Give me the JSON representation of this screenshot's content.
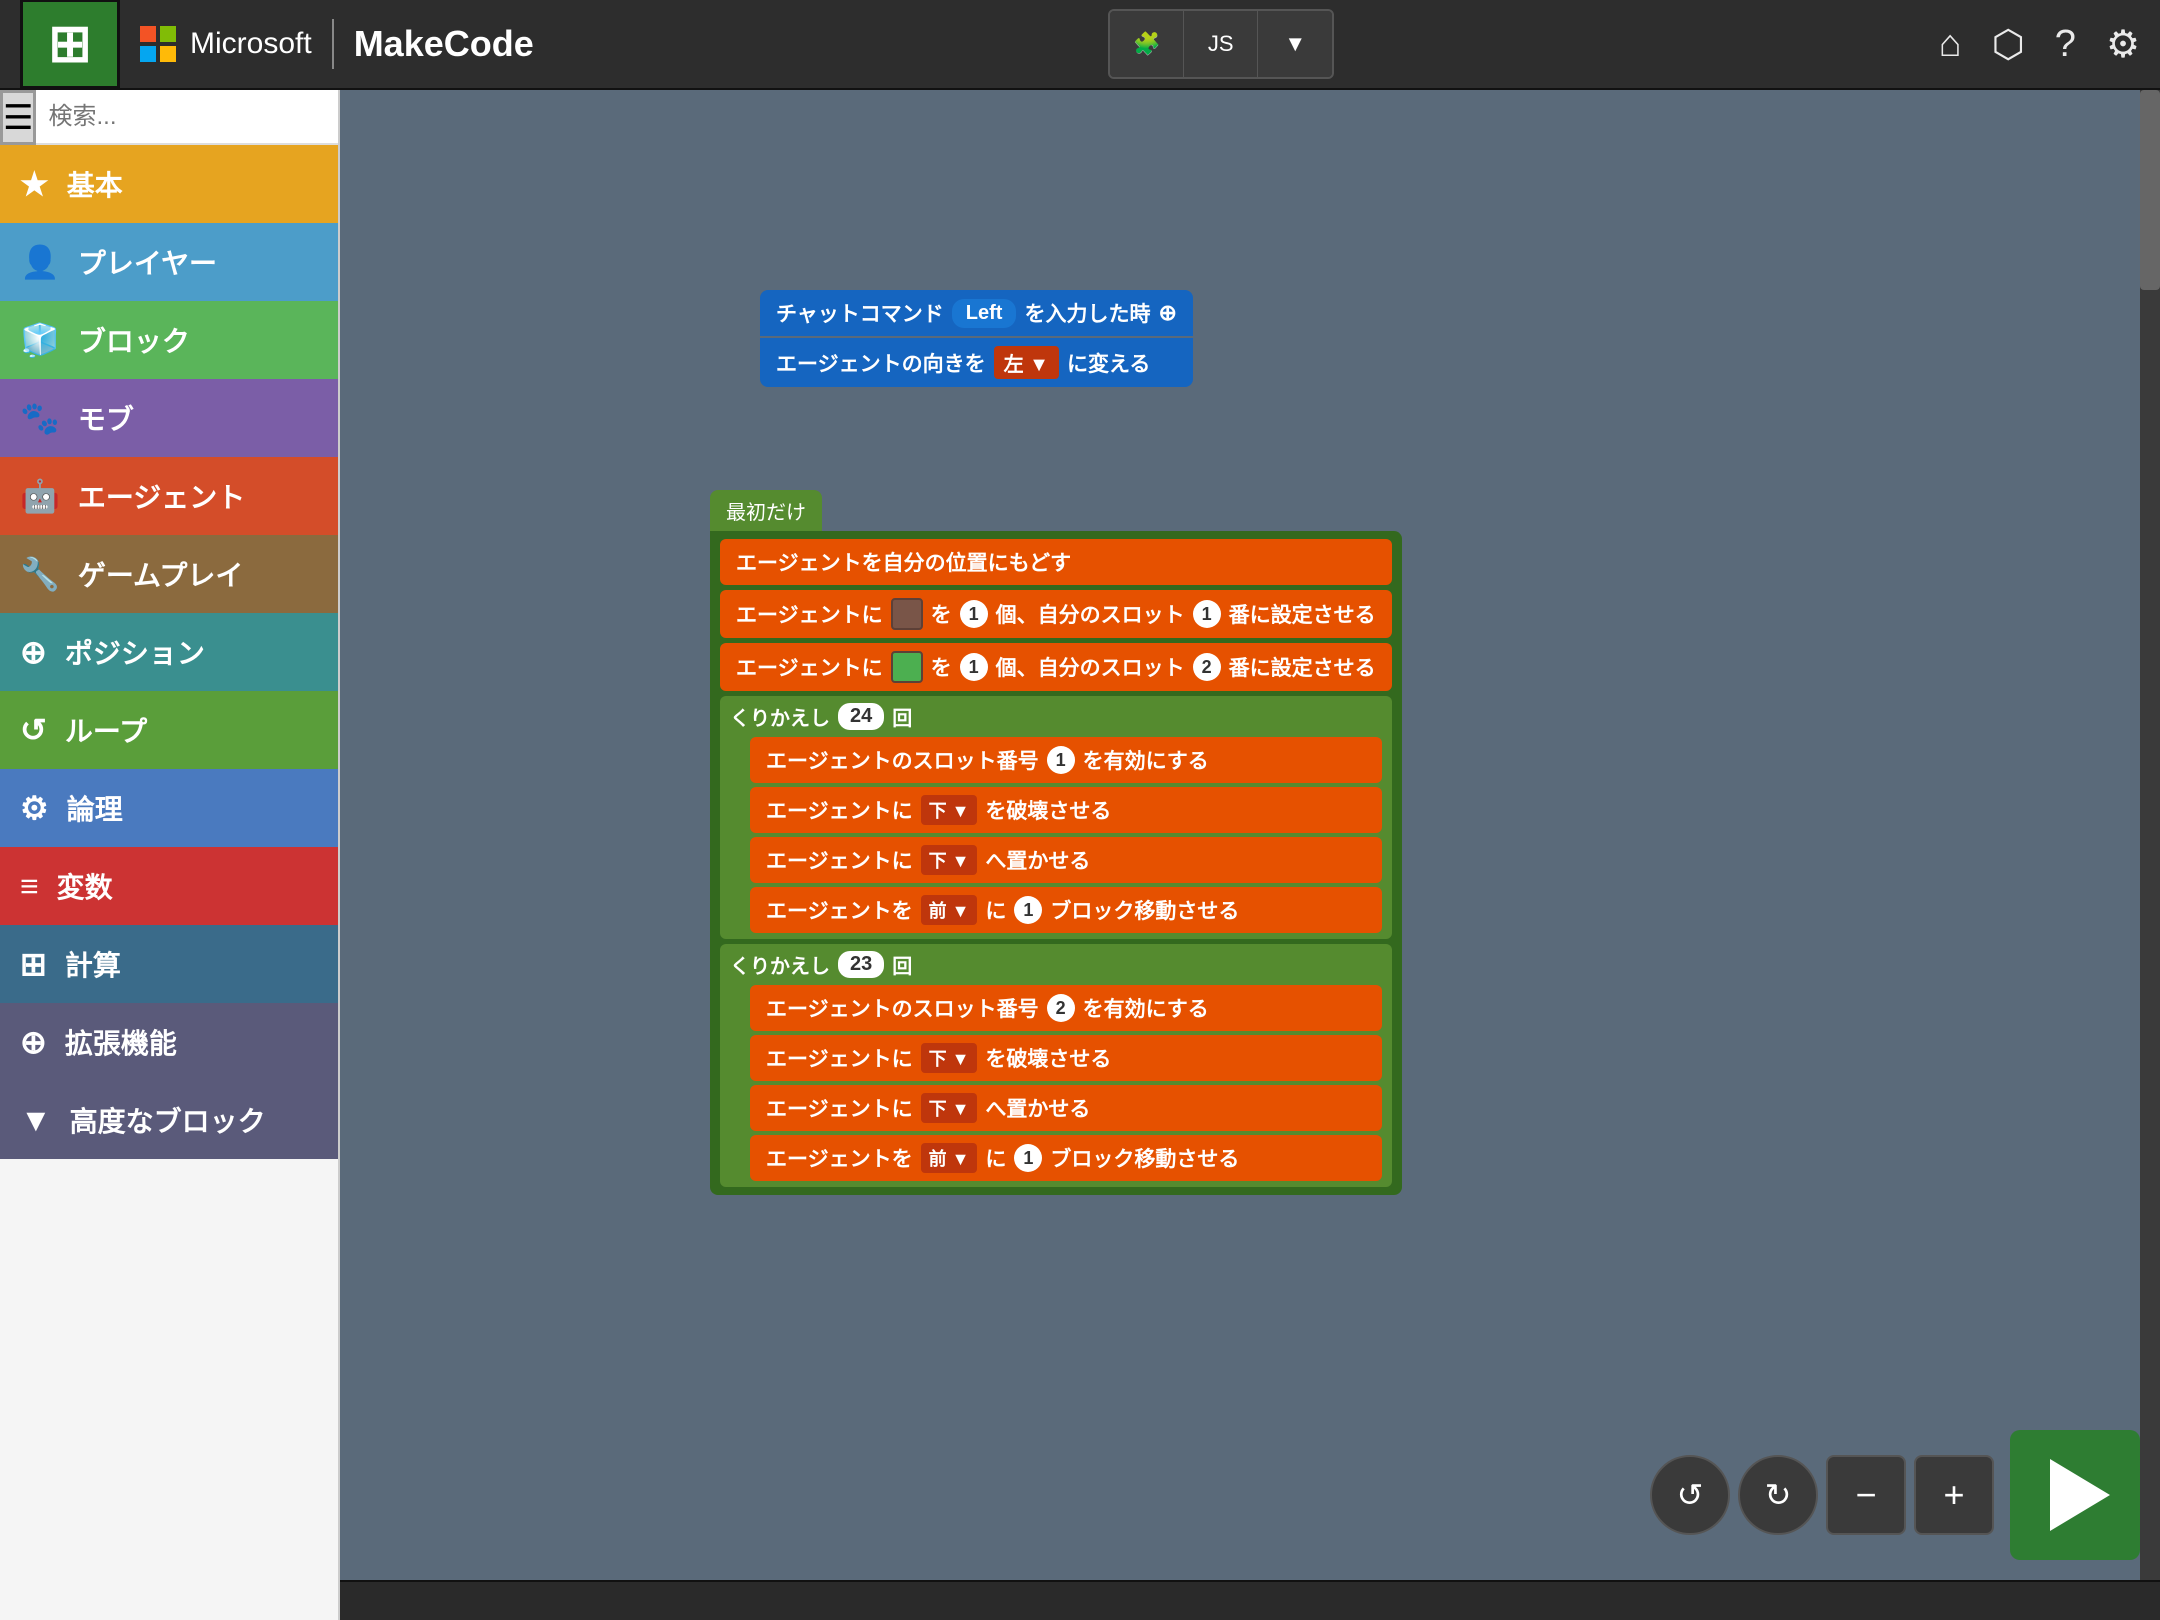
{
  "header": {
    "title": "MakeCode",
    "ms_label": "Microsoft",
    "tab_blocks": "🧩",
    "tab_js": "JS",
    "tab_dropdown": "▼"
  },
  "sidebar": {
    "search_placeholder": "検索...",
    "categories": [
      {
        "id": "basic",
        "label": "基本",
        "icon": "★",
        "color": "#e6a420"
      },
      {
        "id": "player",
        "label": "プレイヤー",
        "icon": "👤",
        "color": "#4c9dc9"
      },
      {
        "id": "block",
        "label": "ブロック",
        "icon": "🧊",
        "color": "#5ab55a"
      },
      {
        "id": "mob",
        "label": "モブ",
        "icon": "🐾",
        "color": "#7b5ea7"
      },
      {
        "id": "agent",
        "label": "エージェント",
        "icon": "🤖",
        "color": "#d44d29"
      },
      {
        "id": "gameplay",
        "label": "ゲームプレイ",
        "icon": "🔧",
        "color": "#8b6a3e"
      },
      {
        "id": "position",
        "label": "ポジション",
        "icon": "⊕",
        "color": "#3a8f8f"
      },
      {
        "id": "loop",
        "label": "ループ",
        "icon": "↺",
        "color": "#5a9e3a"
      },
      {
        "id": "logic",
        "label": "論理",
        "icon": "⚙",
        "color": "#4a7abf"
      },
      {
        "id": "variable",
        "label": "変数",
        "icon": "≡",
        "color": "#cc3333"
      },
      {
        "id": "math",
        "label": "計算",
        "icon": "⊞",
        "color": "#3a6b8a"
      },
      {
        "id": "extend",
        "label": "拡張機能",
        "icon": "⊕",
        "color": "#5a5a7a"
      },
      {
        "id": "advanced",
        "label": "高度なブロック",
        "icon": "▼",
        "color": "#5a5a7a"
      }
    ]
  },
  "canvas": {
    "chat_block": {
      "label": "チャットコマンド",
      "pill": "Left",
      "suffix": "を入力した時",
      "add_icon": "⊕"
    },
    "agent_face_block": "エージェントの向きを　左 ▼　に変える",
    "on_start_label": "最初だけ",
    "blocks": [
      "エージェントを自分の位置にもどす",
      "エージェントに　[item1]　を　1　個、自分のスロット　1　番に設定させる",
      "エージェントに　[item2]　を　1　個、自分のスロット　2　番に設定させる",
      "くりかえし　24　回",
      "エージェントのスロット番号　1　を有効にする",
      "エージェントに　下 ▼　を破壊させる",
      "エージェントに　下 ▼　へ置かせる",
      "エージェントを　前 ▼　に　1　ブロック移動させる",
      "くりかえし　23　回",
      "エージェントのスロット番号　2　を有効にする",
      "エージェントに　下 ▼　を破壊させる",
      "エージェントに　下 ▼　へ置かせる",
      "エージェントを　前 ▼　に　1　ブロック移動させる"
    ]
  },
  "controls": {
    "undo": "↺",
    "redo": "↻",
    "zoom_out": "−",
    "zoom_in": "+",
    "run": "▶"
  }
}
